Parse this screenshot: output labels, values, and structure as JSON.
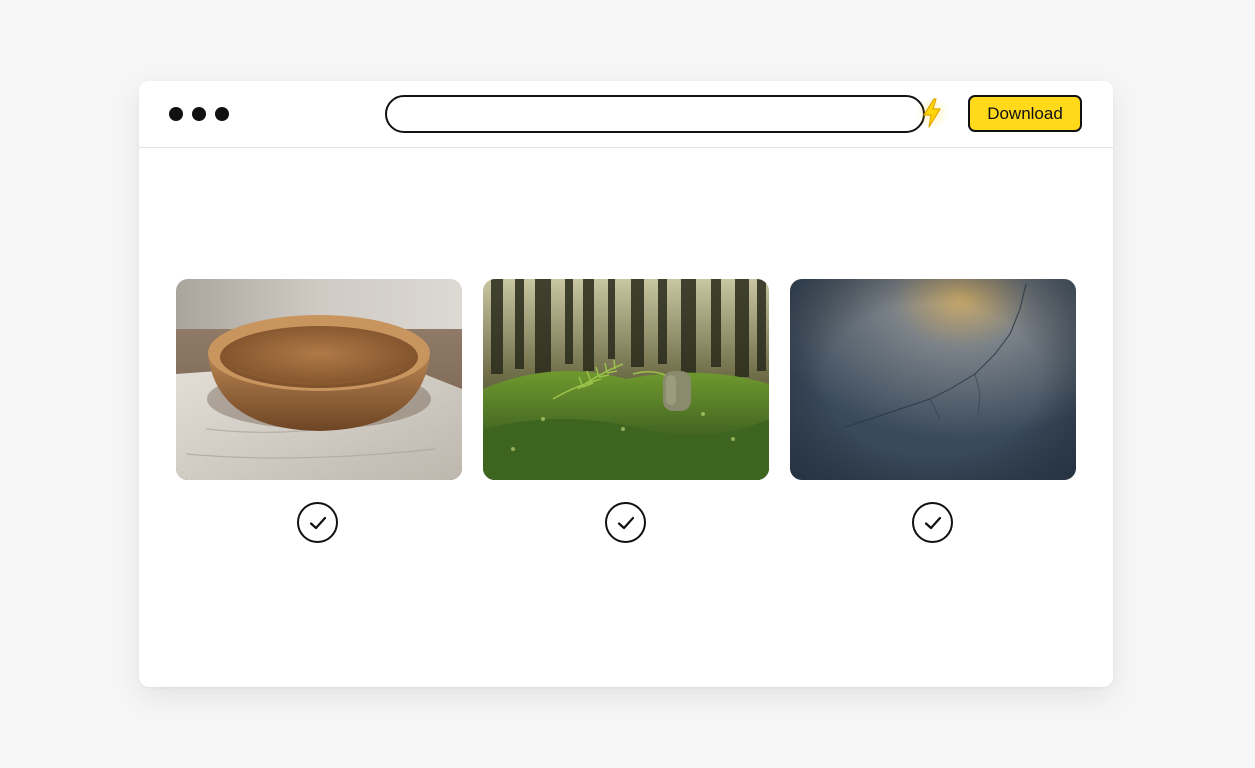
{
  "toolbar": {
    "window_controls": [
      "dot",
      "dot",
      "dot"
    ],
    "address_value": "",
    "address_placeholder": "",
    "bolt_icon": "lightning-bolt-icon",
    "download_label": "Download",
    "accent_color": "#ffd91a"
  },
  "gallery": {
    "images": [
      {
        "subject": "wooden-bowl-photo",
        "selected": true
      },
      {
        "subject": "mossy-forest-photo",
        "selected": true
      },
      {
        "subject": "blue-plaster-texture-photo",
        "selected": true
      }
    ],
    "check_icon": "checkmark-icon"
  }
}
